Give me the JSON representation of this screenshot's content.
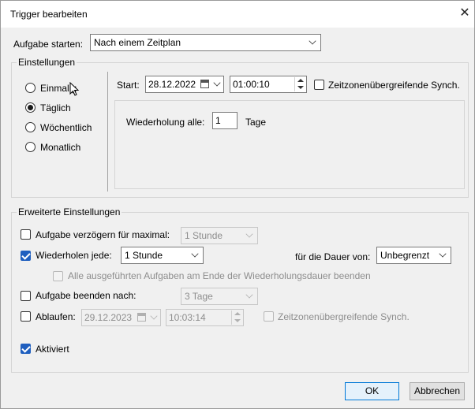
{
  "dialog": {
    "title": "Trigger bearbeiten",
    "close_glyph": "✕"
  },
  "start_task": {
    "label": "Aufgabe starten:",
    "value": "Nach einem Zeitplan"
  },
  "settings": {
    "group_title": "Einstellungen",
    "radios": [
      {
        "label": "Einmalig",
        "selected": false
      },
      {
        "label": "Täglich",
        "selected": true
      },
      {
        "label": "Wöchentlich",
        "selected": false
      },
      {
        "label": "Monatlich",
        "selected": false
      }
    ],
    "start_label": "Start:",
    "start_date": "28.12.2022",
    "start_time": "01:00:10",
    "tz_sync_label": "Zeitzonenübergreifende Synch.",
    "repeat_every_label": "Wiederholung alle:",
    "repeat_every_value": "1",
    "repeat_every_unit": "Tage"
  },
  "advanced": {
    "group_title": "Erweiterte Einstellungen",
    "delay_label": "Aufgabe verzögern für maximal:",
    "delay_value": "1 Stunde",
    "repeat_label": "Wiederholen jede:",
    "repeat_value": "1 Stunde",
    "duration_label": "für die Dauer von:",
    "duration_value": "Unbegrenzt",
    "stop_all_label": "Alle ausgeführten Aufgaben am Ende der Wiederholungsdauer beenden",
    "stop_after_label": "Aufgabe beenden nach:",
    "stop_after_value": "3 Tage",
    "expire_label": "Ablaufen:",
    "expire_date": "29.12.2023",
    "expire_time": "10:03:14",
    "expire_tz_label": "Zeitzonenübergreifende Synch.",
    "enabled_label": "Aktiviert"
  },
  "buttons": {
    "ok": "OK",
    "cancel": "Abbrechen"
  },
  "icons": {
    "close": "close-icon",
    "dropdown": "chevron-down-icon",
    "calendar": "calendar-icon",
    "spinner": "spinner-icon",
    "cursor": "mouse-cursor-icon"
  }
}
